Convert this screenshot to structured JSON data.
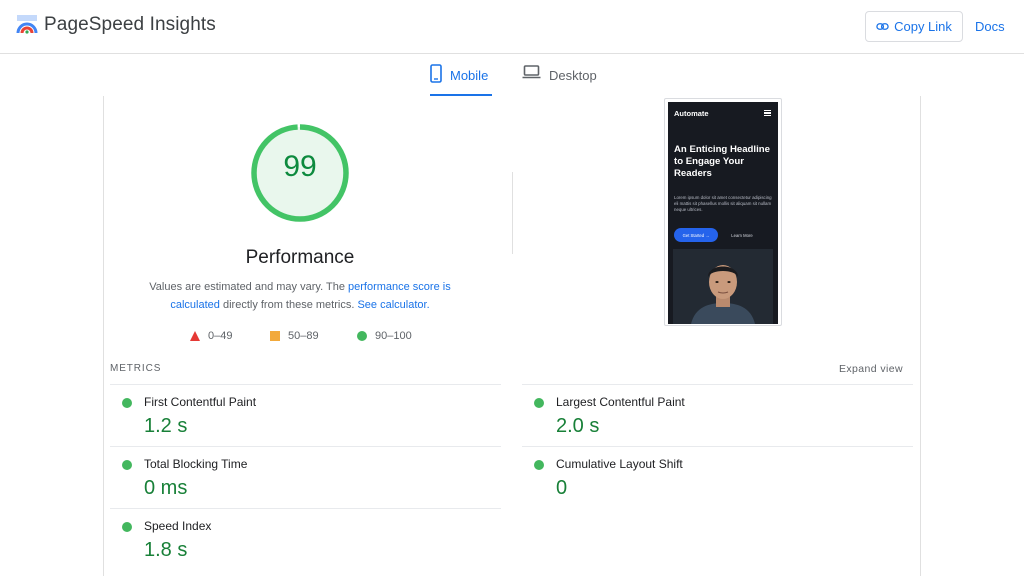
{
  "app": {
    "title": "PageSpeed Insights",
    "logo_icon": "pagespeed-logo-icon"
  },
  "header": {
    "copy_link_label": "Copy Link",
    "docs_label": "Docs"
  },
  "tabs": [
    {
      "label": "Mobile",
      "icon": "smartphone-icon",
      "active": true
    },
    {
      "label": "Desktop",
      "icon": "laptop-icon",
      "active": false
    }
  ],
  "performance": {
    "score": "99",
    "score_fraction": 0.99,
    "title": "Performance",
    "desc_prefix": "Values are estimated and may vary. The ",
    "desc_link1": "performance score is calculated",
    "desc_middle": " directly from these metrics. ",
    "desc_link2": "See calculator.",
    "colors": {
      "good": "#0cce6b",
      "average": "#ffa400",
      "poor": "#ff4e42"
    }
  },
  "legend": [
    {
      "range": "0–49",
      "shape": "triangle",
      "color": "#e53935"
    },
    {
      "range": "50–89",
      "shape": "square",
      "color": "#f2a93b"
    },
    {
      "range": "90–100",
      "shape": "circle",
      "color": "#43b75e"
    }
  ],
  "screenshot": {
    "brand": "Automate",
    "headline": "An Enticing Headline to Engage Your Readers",
    "body": "Lorem ipsum dolor sit amet consectetur adipiscing eli mattis sit phasellus mollis sit aliquam sit nullam neque ultrices.",
    "primary_button": "Get Started →",
    "secondary_button": "Learn More"
  },
  "metrics": {
    "section_label": "METRICS",
    "expand_label": "Expand view",
    "items": [
      {
        "name": "First Contentful Paint",
        "value": "1.2 s",
        "status": "good"
      },
      {
        "name": "Largest Contentful Paint",
        "value": "2.0 s",
        "status": "good"
      },
      {
        "name": "Total Blocking Time",
        "value": "0 ms",
        "status": "good"
      },
      {
        "name": "Cumulative Layout Shift",
        "value": "0",
        "status": "good"
      },
      {
        "name": "Speed Index",
        "value": "1.8 s",
        "status": "good"
      }
    ]
  }
}
